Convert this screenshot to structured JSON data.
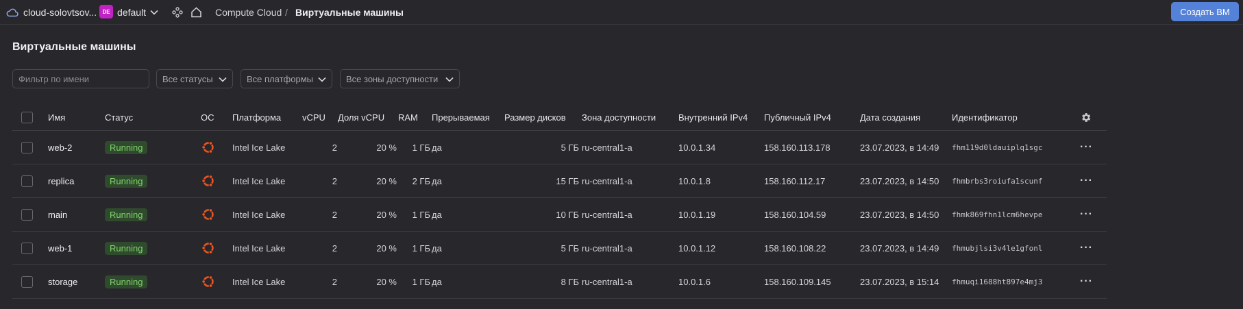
{
  "header": {
    "cloud_name": "cloud-solovtsov...",
    "folder_badge": "DE",
    "folder_name": "default",
    "breadcrumb_service": "Compute Cloud",
    "breadcrumb_sep": "/",
    "breadcrumb_current": "Виртуальные машины",
    "create_button": "Создать ВМ"
  },
  "page": {
    "title": "Виртуальные машины"
  },
  "filters": {
    "name_placeholder": "Фильтр по имени",
    "status": "Все статусы",
    "platform": "Все платформы",
    "zone": "Все зоны доступности"
  },
  "table": {
    "columns": {
      "name": "Имя",
      "status": "Статус",
      "os": "ОС",
      "platform": "Платформа",
      "vcpu": "vCPU",
      "vcpu_share": "Доля vCPU",
      "ram": "RAM",
      "preemptible": "Прерываемая",
      "disk": "Размер дисков",
      "zone": "Зона доступности",
      "internal_ip": "Внутренний IPv4",
      "public_ip": "Публичный IPv4",
      "created": "Дата создания",
      "id": "Идентификатор"
    },
    "rows": [
      {
        "name": "web-2",
        "status": "Running",
        "platform": "Intel Ice Lake",
        "vcpu": "2",
        "vcpu_share": "20 %",
        "ram": "1 ГБ",
        "preemptible": "да",
        "disk": "5 ГБ",
        "zone": "ru-central1-a",
        "internal_ip": "10.0.1.34",
        "public_ip": "158.160.113.178",
        "created": "23.07.2023, в 14:49",
        "id": "fhm119d0ldauiplq1sgc"
      },
      {
        "name": "replica",
        "status": "Running",
        "platform": "Intel Ice Lake",
        "vcpu": "2",
        "vcpu_share": "20 %",
        "ram": "2 ГБ",
        "preemptible": "да",
        "disk": "15 ГБ",
        "zone": "ru-central1-a",
        "internal_ip": "10.0.1.8",
        "public_ip": "158.160.112.17",
        "created": "23.07.2023, в 14:50",
        "id": "fhmbrbs3roiufa1scunf"
      },
      {
        "name": "main",
        "status": "Running",
        "platform": "Intel Ice Lake",
        "vcpu": "2",
        "vcpu_share": "20 %",
        "ram": "1 ГБ",
        "preemptible": "да",
        "disk": "10 ГБ",
        "zone": "ru-central1-a",
        "internal_ip": "10.0.1.19",
        "public_ip": "158.160.104.59",
        "created": "23.07.2023, в 14:50",
        "id": "fhmk869fhn1lcm6hevpe"
      },
      {
        "name": "web-1",
        "status": "Running",
        "platform": "Intel Ice Lake",
        "vcpu": "2",
        "vcpu_share": "20 %",
        "ram": "1 ГБ",
        "preemptible": "да",
        "disk": "5 ГБ",
        "zone": "ru-central1-a",
        "internal_ip": "10.0.1.12",
        "public_ip": "158.160.108.22",
        "created": "23.07.2023, в 14:49",
        "id": "fhmubjlsi3v4le1gfonl"
      },
      {
        "name": "storage",
        "status": "Running",
        "platform": "Intel Ice Lake",
        "vcpu": "2",
        "vcpu_share": "20 %",
        "ram": "1 ГБ",
        "preemptible": "да",
        "disk": "8 ГБ",
        "zone": "ru-central1-a",
        "internal_ip": "10.0.1.6",
        "public_ip": "158.160.109.145",
        "created": "23.07.2023, в 15:14",
        "id": "fhmuqi1688ht897e4mj3"
      }
    ]
  },
  "icons": {
    "cloud": "cloud-icon",
    "chevron": "chevron-down-icon",
    "services": "services-icon",
    "home": "home-icon",
    "os": "ubuntu-icon",
    "settings": "gear-icon",
    "more": "more-icon"
  },
  "colors": {
    "accent": "#5582d9",
    "running_bg": "#2f4a2c",
    "running_text": "#7ed66a",
    "ubuntu": "#e95420",
    "folder_badge": "#c022c4"
  }
}
